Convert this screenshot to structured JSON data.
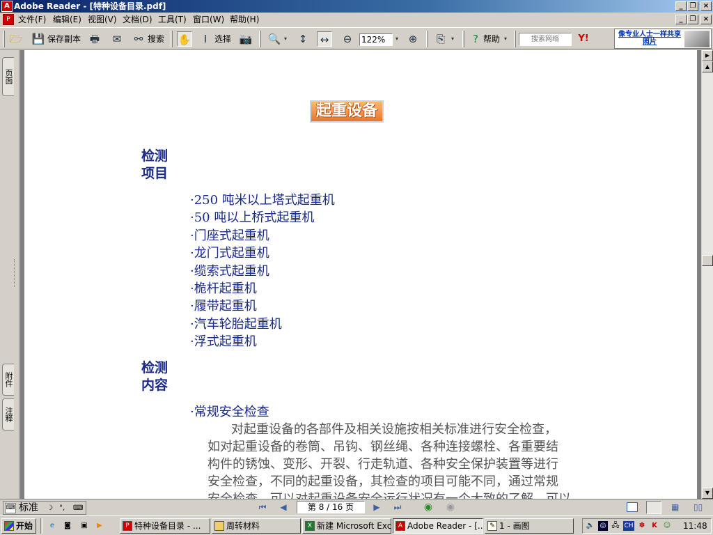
{
  "window": {
    "title": "Adobe Reader - [特种设备目录.pdf]"
  },
  "menu": [
    "文件(F)",
    "编辑(E)",
    "视图(V)",
    "文档(D)",
    "工具(T)",
    "窗口(W)",
    "帮助(H)"
  ],
  "toolbar": {
    "save_copy": "保存副本",
    "search": "搜索",
    "select": "选择",
    "zoom": "122%",
    "help": "帮助",
    "web_search_placeholder": "搜索网络",
    "yahoo": "Y!",
    "promo": "像专业人士一样共享照片"
  },
  "nav_tabs": {
    "pages": "页面",
    "attachments": "附件",
    "comments": "注释"
  },
  "document": {
    "banner": "起重设备",
    "section1": "检测\n项目",
    "items": [
      "·250 吨米以上塔式起重机",
      "·50 吨以上桥式起重机",
      "·门座式起重机",
      "·龙门式起重机",
      "·缆索式起重机",
      "·桅杆起重机",
      "·履带起重机",
      "·汽车轮胎起重机",
      "·浮式起重机"
    ],
    "section2": "检测\n内容",
    "content_title": "·常规安全检查",
    "paragraph": [
      "对起重设备的各部件及相关设施按相关标准进行安全检查，",
      "如对起重设备的卷筒、吊钩、钢丝绳、各种连接螺栓、各重要结",
      "构件的锈蚀、变形、开裂、行走轨道、各种安全保护装置等进行",
      "安全检查，不同的起重设备，其检查的项目可能不同，通过常规",
      "安全检查，可以对起重设备安全运行状况有一个大致的了解，可以"
    ]
  },
  "status": {
    "page_display": "第 8 / 16 页",
    "ime": "标准"
  },
  "taskbar": {
    "start": "开始",
    "tasks": [
      "特种设备目录 - ...",
      "周转材料",
      "新建 Microsoft Exc...",
      "Adobe Reader - [...",
      "1 - 画图"
    ],
    "clock": "11:48",
    "lang": "CH"
  }
}
